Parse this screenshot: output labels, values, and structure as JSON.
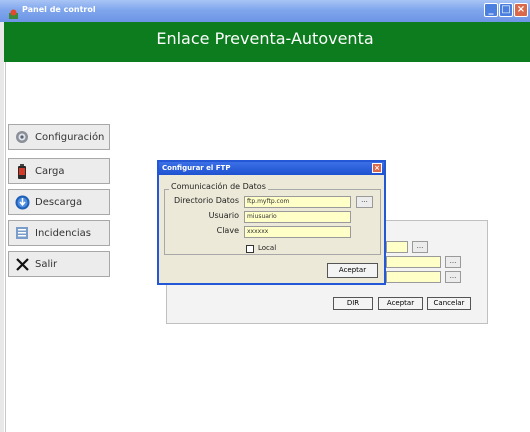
{
  "window": {
    "title": "Panel de control"
  },
  "header": {
    "title": "Enlace Preventa-Autoventa"
  },
  "sidebar": {
    "items": [
      {
        "label": "Configuración",
        "icon": "gear-icon"
      },
      {
        "label": "Carga",
        "icon": "battery-icon"
      },
      {
        "label": "Descarga",
        "icon": "download-globe-icon"
      },
      {
        "label": "Incidencias",
        "icon": "list-icon"
      },
      {
        "label": "Salir",
        "icon": "close-x-icon"
      }
    ]
  },
  "background_panel": {
    "dir_button": "DIR",
    "accept_button": "Aceptar",
    "cancel_button": "Cancelar",
    "browse_label": "..."
  },
  "dialog": {
    "title": "Configurar el FTP",
    "group_title": "Comunicación de Datos",
    "fields": {
      "directorio_label": "Directorio Datos",
      "directorio_value": "ftp.myftp.com",
      "usuario_label": "Usuario",
      "usuario_value": "miusuario",
      "clave_label": "Clave",
      "clave_value": "xxxxxx"
    },
    "local_label": "Local",
    "local_checked": false,
    "browse_label": "...",
    "accept_button": "Aceptar"
  },
  "colors": {
    "header_green": "#0c7c1e",
    "title_blue": "#7fa6ec",
    "field_yellow": "#ffffc8",
    "dialog_border": "#2457d6"
  }
}
